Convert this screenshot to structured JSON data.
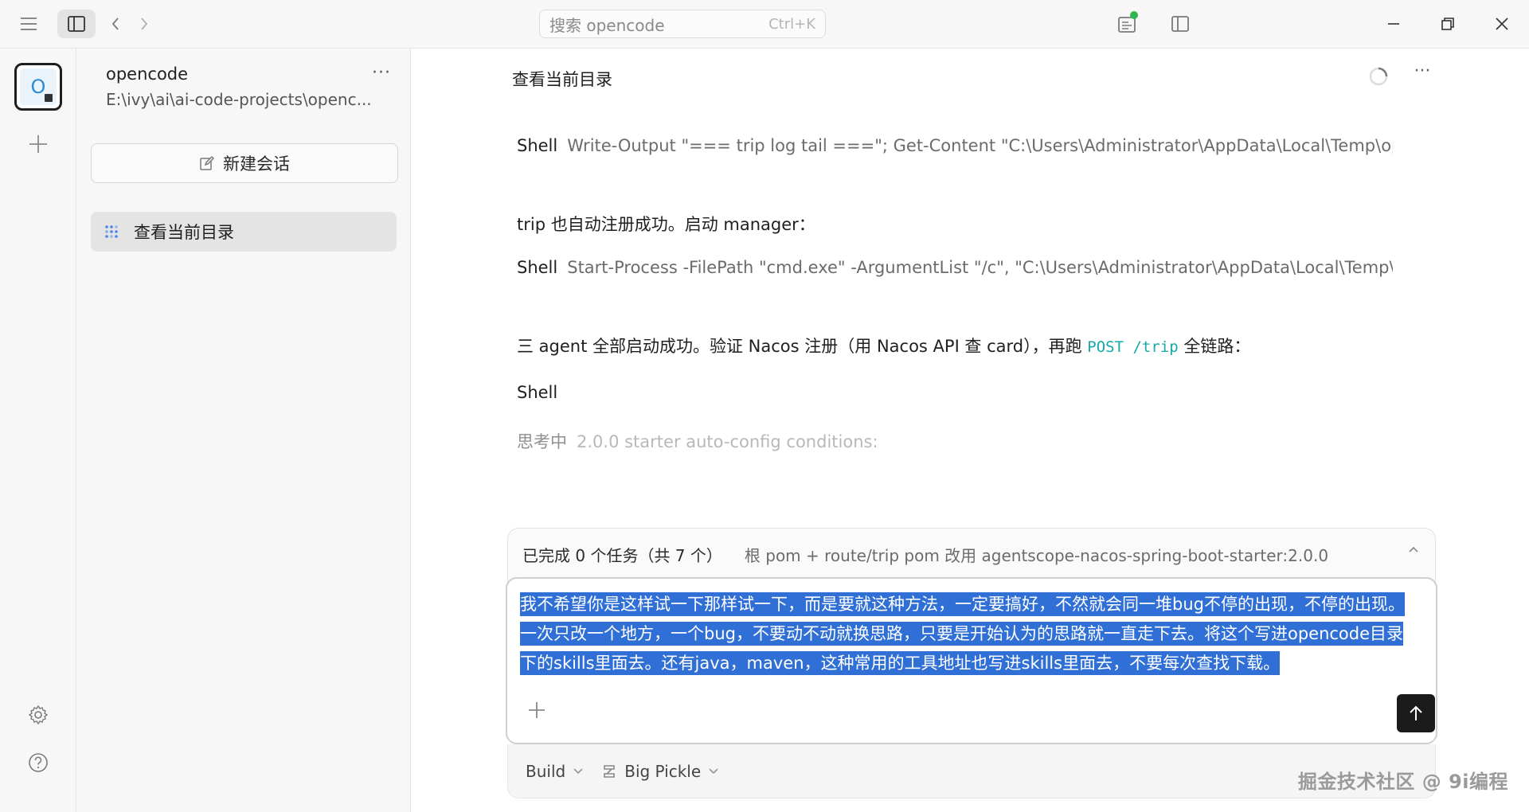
{
  "titlebar": {
    "search_placeholder": "搜索 opencode",
    "search_shortcut": "Ctrl+K",
    "icons": [
      "menu-icon",
      "sidebar-toggle-icon",
      "back-icon",
      "forward-icon",
      "panel-icon",
      "layout-icon",
      "minimize-icon",
      "maximize-icon",
      "close-icon"
    ],
    "status_dot_color": "#2db84d"
  },
  "rail": {
    "project_initial": "O"
  },
  "sidebar": {
    "project_name": "opencode",
    "project_path": "E:\\ivy\\ai\\ai-code-projects\\openc...",
    "more_label": "···",
    "new_chat_label": "新建会话",
    "sessions": [
      {
        "label": "查看当前目录"
      }
    ]
  },
  "main": {
    "title": "查看当前目录",
    "more_label": "···",
    "messages": [
      {
        "type": "shell",
        "tool": "Shell",
        "command": "Write-Output \"=== trip log tail ===\"; Get-Content \"C:\\Users\\Administrator\\AppData\\Local\\Temp\\openc"
      },
      {
        "type": "text",
        "text": "trip 也自动注册成功。启动 manager："
      },
      {
        "type": "shell",
        "tool": "Shell",
        "command": "Start-Process -FilePath \"cmd.exe\" -ArgumentList \"/c\", \"C:\\Users\\Administrator\\AppData\\Local\\Temp\\ope"
      },
      {
        "type": "text",
        "text_before": "三 agent 全部启动成功。验证 Nacos 注册（用 Nacos API 查 card），再跑 ",
        "code": "POST /trip",
        "text_after": " 全链路："
      },
      {
        "type": "shell",
        "tool": "Shell",
        "command": ""
      },
      {
        "type": "thinking",
        "label": "思考中",
        "detail": "2.0.0 starter auto-config conditions:"
      }
    ],
    "tasks": {
      "summary": "已完成 0 个任务（共 7 个）",
      "current": "根 pom + route/trip pom 改用 agentscope-nacos-spring-boot-starter:2.0.0"
    },
    "composer": {
      "text": "我不希望你是这样试一下那样试一下，而是要就这种方法，一定要搞好，不然就会同一堆bug不停的出现，不停的出现。一次只改一个地方，一个bug，不要动不动就换思路，只要是开始认为的思路就一直走下去。将这个写进opencode目录下的skills里面去。还有java，maven，这种常用的工具地址也写进skills里面去，不要每次查找下载。",
      "selection_color": "#2f6fd6"
    },
    "footer": {
      "mode": "Build",
      "model": "Big Pickle"
    }
  },
  "watermark": "掘金技术社区 @ 9i编程"
}
